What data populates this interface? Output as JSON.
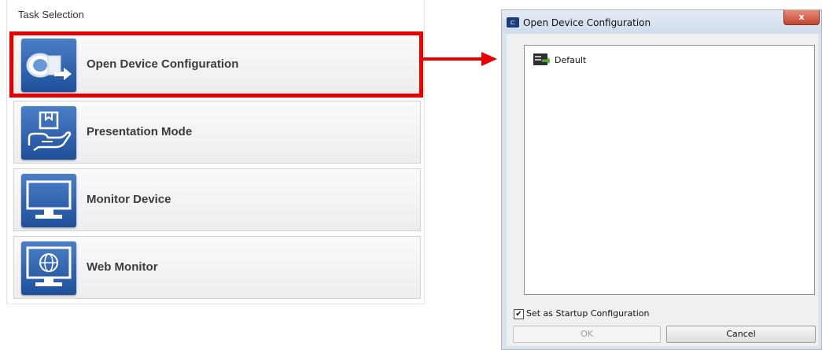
{
  "task_panel": {
    "title": "Task Selection",
    "items": [
      {
        "label": "Open Device Configuration",
        "icon": "open-device-configuration-icon"
      },
      {
        "label": "Presentation Mode",
        "icon": "presentation-mode-icon"
      },
      {
        "label": "Monitor Device",
        "icon": "monitor-device-icon"
      },
      {
        "label": "Web Monitor",
        "icon": "web-monitor-icon"
      }
    ],
    "highlight_color": "#e60000"
  },
  "dialog": {
    "title": "Open Device Configuration",
    "close_glyph": "x",
    "configurations": [
      {
        "label": "Default",
        "icon": "configuration-icon"
      }
    ],
    "startup_checkbox": {
      "label": "Set as Startup Configuration",
      "checked": true
    },
    "ok_label": "OK",
    "cancel_label": "Cancel"
  }
}
